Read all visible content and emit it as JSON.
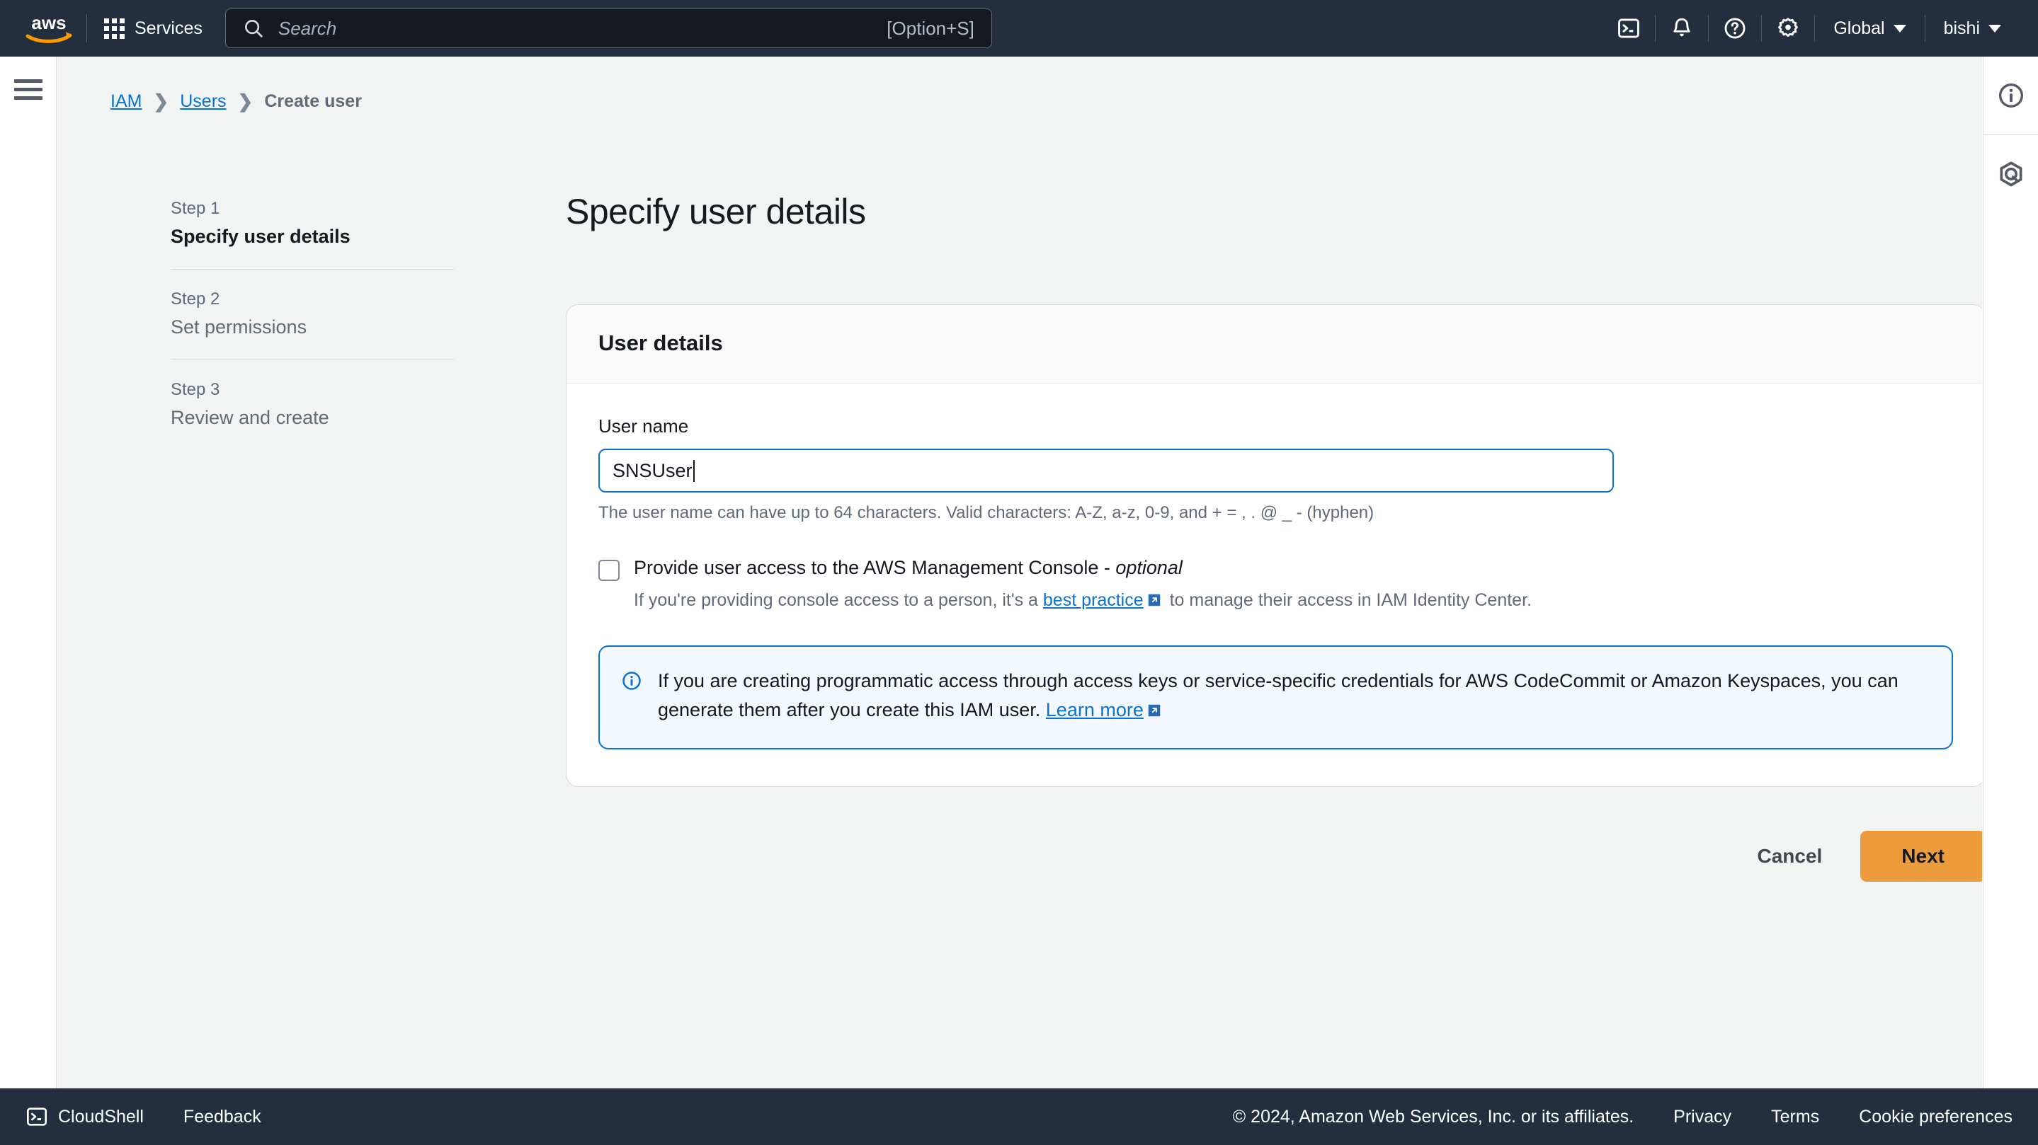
{
  "topnav": {
    "logo_alt": "aws",
    "services_label": "Services",
    "search": {
      "placeholder": "Search",
      "shortcut": "[Option+S]",
      "value": ""
    },
    "region_label": "Global",
    "account_label": "bishi",
    "icons": [
      "cloudshell-icon",
      "notifications-bell-icon",
      "help-question-icon",
      "settings-gear-icon"
    ]
  },
  "breadcrumb": {
    "items": [
      {
        "label": "IAM",
        "link": true
      },
      {
        "label": "Users",
        "link": true
      },
      {
        "label": "Create user",
        "link": false
      }
    ]
  },
  "wizard": {
    "steps": [
      {
        "num": "Step 1",
        "title": "Specify user details",
        "active": true
      },
      {
        "num": "Step 2",
        "title": "Set permissions",
        "active": false
      },
      {
        "num": "Step 3",
        "title": "Review and create",
        "active": false
      }
    ]
  },
  "main": {
    "page_title": "Specify user details",
    "panel": {
      "heading": "User details",
      "username_label": "User name",
      "username_value": "SNSUser",
      "username_placeholder": "",
      "username_hint": "The user name can have up to 64 characters. Valid characters: A-Z, a-z, 0-9, and + = , . @ _ - (hyphen)",
      "console_checkbox": {
        "checked": false,
        "label_main": "Provide user access to the AWS Management Console - ",
        "label_em": "optional",
        "sub_prefix": "If you're providing console access to a person, it's a ",
        "sub_link": "best practice",
        "sub_suffix": " to manage their access in IAM Identity Center."
      },
      "alert": {
        "icon": "info-circle-icon",
        "text_1": "If you are creating programmatic access through access keys or service-specific credentials for AWS CodeCommit or Amazon Keyspaces, you can generate them after you create this IAM user. ",
        "link": "Learn more"
      }
    },
    "actions": {
      "cancel_label": "Cancel",
      "next_label": "Next"
    }
  },
  "right_rail": {
    "icons": [
      "info-circle-icon",
      "amazon-q-hexagon-icon"
    ]
  },
  "footer": {
    "cloudshell_label": "CloudShell",
    "feedback_label": "Feedback",
    "copyright": "© 2024, Amazon Web Services, Inc. or its affiliates.",
    "links": [
      "Privacy",
      "Terms",
      "Cookie preferences"
    ]
  },
  "colors": {
    "nav_background": "#232f3e",
    "accent_blue": "#0972d3",
    "next_button": "#ec9c3d",
    "content_background": "#f2f3f3",
    "alert_background": "#f2f8fd"
  }
}
